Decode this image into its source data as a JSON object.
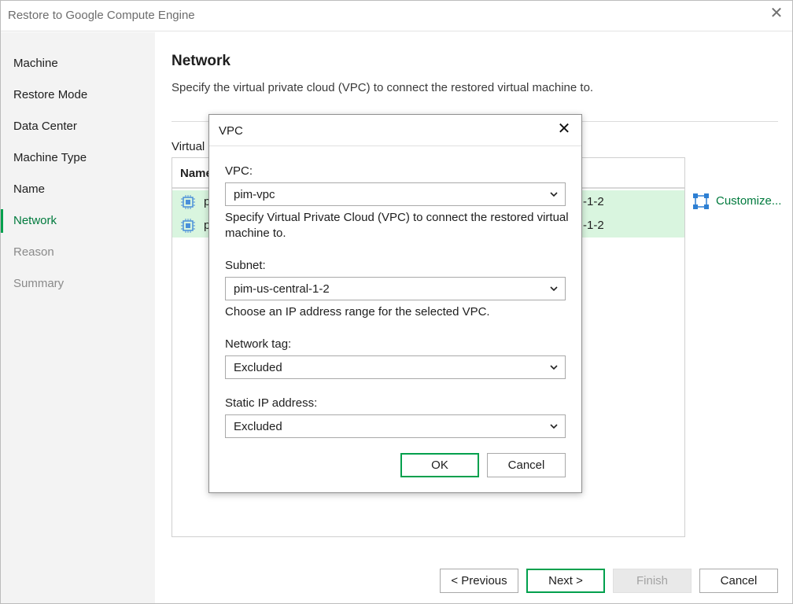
{
  "window": {
    "title": "Restore to Google Compute Engine"
  },
  "sidebar": {
    "items": [
      {
        "label": "Machine",
        "state": "normal"
      },
      {
        "label": "Restore Mode",
        "state": "normal"
      },
      {
        "label": "Data Center",
        "state": "normal"
      },
      {
        "label": "Machine Type",
        "state": "normal"
      },
      {
        "label": "Name",
        "state": "normal"
      },
      {
        "label": "Network",
        "state": "active"
      },
      {
        "label": "Reason",
        "state": "disabled"
      },
      {
        "label": "Summary",
        "state": "disabled"
      }
    ]
  },
  "main": {
    "title": "Network",
    "description": "Specify the virtual private cloud (VPC) to connect the restored virtual machine to.",
    "vm_label": "Virtual",
    "grid": {
      "column_name": "Name",
      "rows": [
        {
          "name": "p",
          "subnet": "-1-2"
        },
        {
          "name": "p",
          "subnet": "-1-2"
        }
      ]
    },
    "customize_label": "Customize..."
  },
  "footer": {
    "previous": "< Previous",
    "next": "Next >",
    "finish": "Finish",
    "cancel": "Cancel"
  },
  "dialog": {
    "title": "VPC",
    "vpc_label": "VPC:",
    "vpc_value": "pim-vpc",
    "vpc_hint": "Specify Virtual Private Cloud (VPC) to connect the restored virtual machine to.",
    "subnet_label": "Subnet:",
    "subnet_value": "pim-us-central-1-2",
    "subnet_hint": "Choose an IP address range for the selected VPC.",
    "tag_label": "Network tag:",
    "tag_value": "Excluded",
    "ip_label": "Static IP address:",
    "ip_value": "Excluded",
    "ok": "OK",
    "cancel": "Cancel"
  },
  "colors": {
    "accent": "#00a04d",
    "accent_text": "#007a3d",
    "row_highlight": "#d9f5df",
    "sidebar_bg": "#f3f3f3"
  },
  "icons": {
    "window_close": "close-icon",
    "vm": "vm-chip-icon",
    "customize": "customize-icon",
    "dropdown": "chevron-down-icon"
  }
}
